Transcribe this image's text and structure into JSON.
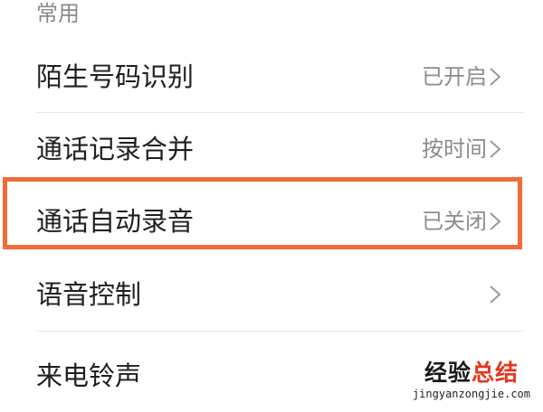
{
  "section": {
    "title": "常用"
  },
  "rows": [
    {
      "label": "陌生号码识别",
      "value": "已开启"
    },
    {
      "label": "通话记录合并",
      "value": "按时间"
    },
    {
      "label": "通话自动录音",
      "value": "已关闭"
    },
    {
      "label": "语音控制",
      "value": ""
    },
    {
      "label": "来电铃声",
      "value": ""
    }
  ],
  "highlight": {
    "color": "#f26c3b"
  },
  "watermark": {
    "title_part1": "经验",
    "title_part2": "总结",
    "url": "jingyanzongjie.com",
    "color_part1": "#1a1a1a",
    "color_part2": "#e8341c"
  },
  "icons": {
    "row_chevron": "chevron-right-icon"
  }
}
